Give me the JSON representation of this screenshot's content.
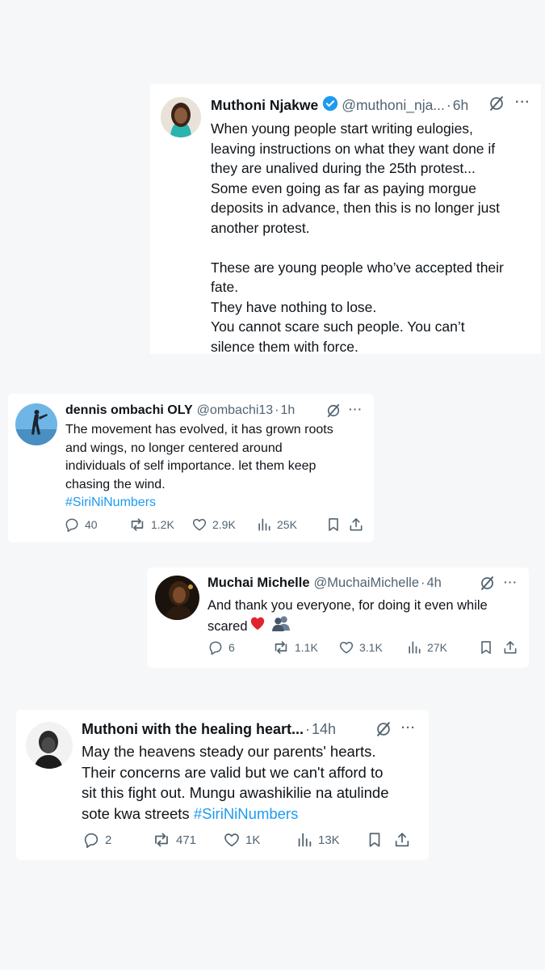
{
  "tweets": [
    {
      "name": "Muthoni Njakwe",
      "handle": "@muthoni_nja...",
      "separator": "·",
      "time": "6h",
      "lines": [
        "When young people start writing eulogies,",
        "leaving instructions on what they want done if",
        "they are unalived during the 25th protest...",
        "Some even going as far as paying morgue",
        "deposits in advance, then this is no longer just",
        "another protest.",
        "",
        "These are young people who’ve accepted their",
        "fate.",
        "They have nothing to lose.",
        "You cannot scare such people. You can’t",
        "silence them with force."
      ]
    },
    {
      "name": "dennis ombachi OLY",
      "handle": "@ombachi13",
      "separator": "·",
      "time": "1h",
      "lines": [
        "The movement has evolved, it has grown roots",
        "and wings, no longer centered around",
        "individuals of self importance. let them keep",
        "chasing the wind."
      ],
      "hashtag": "#SiriNiNumbers",
      "replies": "40",
      "reposts": "1.2K",
      "likes": "2.9K",
      "views": "25K"
    },
    {
      "name": "Muchai Michelle",
      "handle": "@MuchaiMichelle",
      "separator": "·",
      "time": "4h",
      "line1": "And thank you everyone, for doing it even while",
      "line2": "scared",
      "emojis": [
        "red-heart",
        "busts-in-silhouette"
      ],
      "replies": "6",
      "reposts": "1.1K",
      "likes": "3.1K",
      "views": "27K"
    },
    {
      "name": "Muthoni with the healing heart...",
      "separator": "·",
      "time": "14h",
      "lines": [
        "May the heavens steady our parents' hearts.",
        "Their concerns are valid but we can't afford to",
        "sit this fight out. Mungu awashikilie na atulinde"
      ],
      "last_line": "sote kwa streets",
      "hashtag": "#SiriNiNumbers",
      "replies": "2",
      "reposts": "471",
      "likes": "1K",
      "views": "13K"
    }
  ],
  "icons": {
    "verified": "verified-badge-icon",
    "grok": "grok-icon",
    "more": "more-icon",
    "reply": "reply-icon",
    "repost": "repost-icon",
    "like": "like-icon",
    "views": "views-icon",
    "bookmark": "bookmark-icon",
    "share": "share-icon"
  },
  "more_glyph": "···",
  "colors": {
    "link": "#1d9bf0",
    "verified": "#1d9bf0",
    "muted": "#536471",
    "text": "#0f1419"
  }
}
